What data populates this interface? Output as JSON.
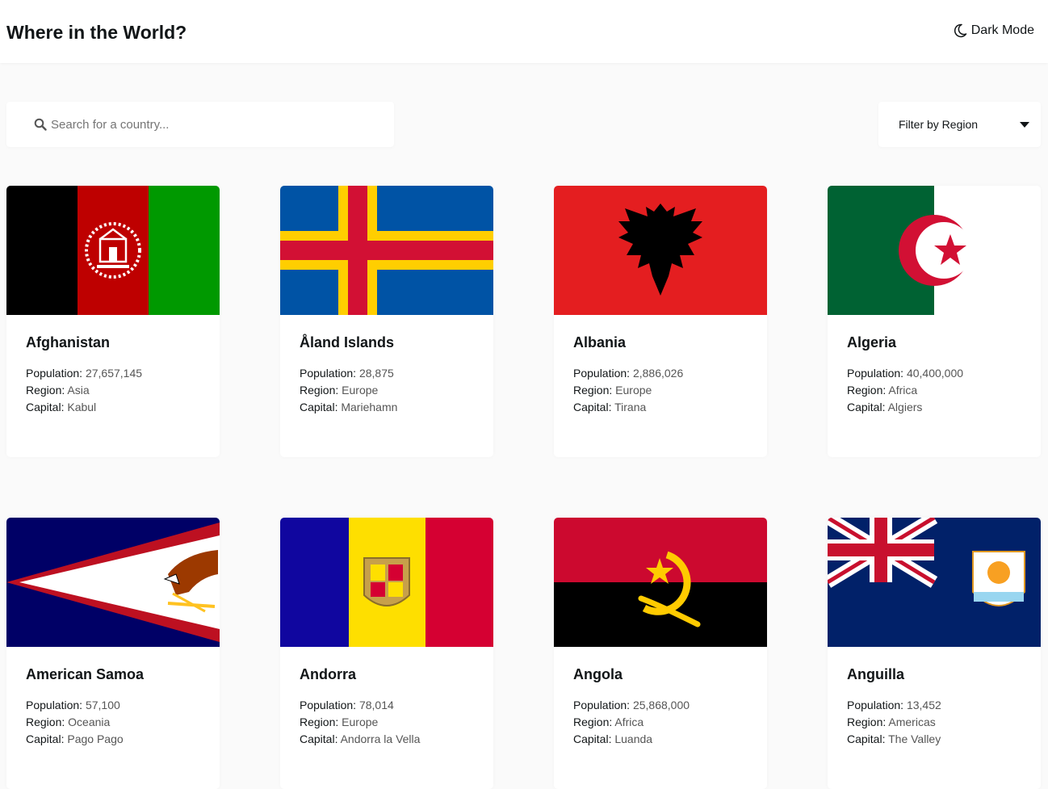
{
  "header": {
    "title": "Where in the World?",
    "mode_label": "Dark Mode"
  },
  "search": {
    "placeholder": "Search for a country..."
  },
  "filter": {
    "label": "Filter by Region"
  },
  "labels": {
    "population": "Population:",
    "region": "Region:",
    "capital": "Capital:"
  },
  "countries": [
    {
      "name": "Afghanistan",
      "population": "27,657,145",
      "region": "Asia",
      "capital": "Kabul"
    },
    {
      "name": "Åland Islands",
      "population": "28,875",
      "region": "Europe",
      "capital": "Mariehamn"
    },
    {
      "name": "Albania",
      "population": "2,886,026",
      "region": "Europe",
      "capital": "Tirana"
    },
    {
      "name": "Algeria",
      "population": "40,400,000",
      "region": "Africa",
      "capital": "Algiers"
    },
    {
      "name": "American Samoa",
      "population": "57,100",
      "region": "Oceania",
      "capital": "Pago Pago"
    },
    {
      "name": "Andorra",
      "population": "78,014",
      "region": "Europe",
      "capital": "Andorra la Vella"
    },
    {
      "name": "Angola",
      "population": "25,868,000",
      "region": "Africa",
      "capital": "Luanda"
    },
    {
      "name": "Anguilla",
      "population": "13,452",
      "region": "Americas",
      "capital": "The Valley"
    }
  ]
}
